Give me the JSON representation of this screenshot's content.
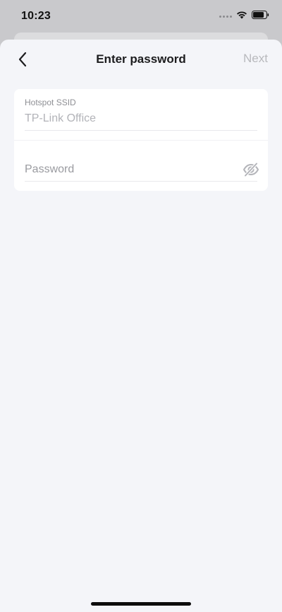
{
  "status_bar": {
    "time": "10:23",
    "icons": [
      "cellular-signal-icon",
      "wifi-icon",
      "battery-icon"
    ]
  },
  "nav": {
    "back_icon": "chevron-left-icon",
    "title": "Enter password",
    "next_label": "Next"
  },
  "form": {
    "ssid": {
      "label": "Hotspot SSID",
      "value": "TP-Link Office"
    },
    "password": {
      "placeholder": "Password",
      "value": "",
      "toggle_icon": "eye-slash-icon"
    }
  },
  "colors": {
    "sheet_background": "#f4f5f9",
    "card_background": "#ffffff",
    "title_text": "#1c1c1e",
    "disabled_text": "#b8b9bd",
    "placeholder_text": "#9a9ba0"
  }
}
